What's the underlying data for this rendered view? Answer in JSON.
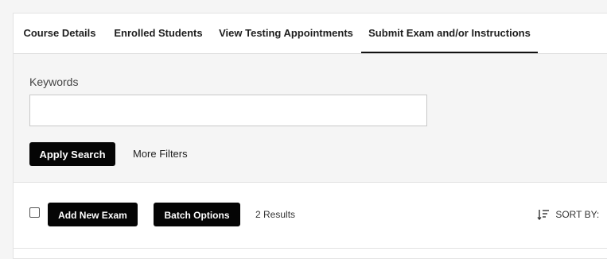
{
  "tabs": [
    {
      "label": "Course Details",
      "active": false
    },
    {
      "label": "Enrolled Students",
      "active": false
    },
    {
      "label": "View Testing Appointments",
      "active": false
    },
    {
      "label": "Submit Exam and/or Instructions",
      "active": true
    }
  ],
  "filter": {
    "keywords_label": "Keywords",
    "keywords_value": "",
    "apply_label": "Apply Search",
    "more_filters_label": "More Filters"
  },
  "toolbar": {
    "add_new_exam_label": "Add New Exam",
    "batch_options_label": "Batch Options",
    "results_text": "2 Results",
    "sort_label": "SORT BY:",
    "sort_icon": "sort-icon"
  },
  "colors": {
    "button_bg": "#050505",
    "button_text": "#ffffff",
    "active_tab_underline": "#111111",
    "page_bg": "#f5f5f5"
  }
}
